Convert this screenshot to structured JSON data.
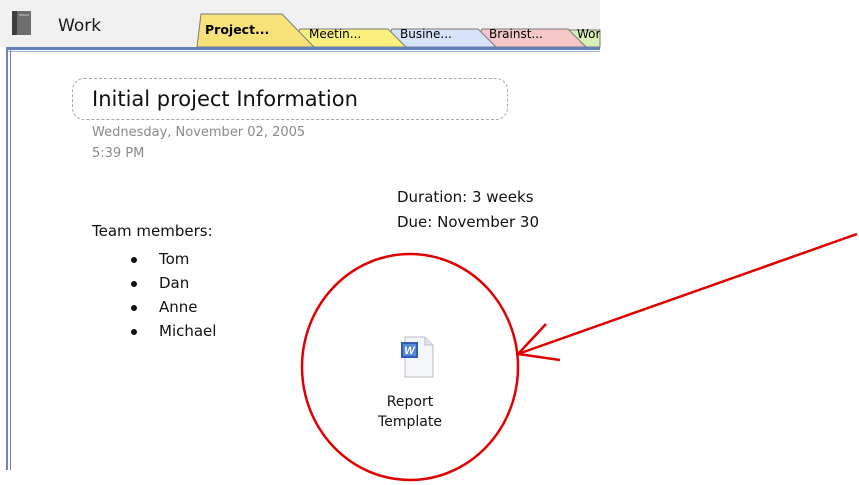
{
  "notebook": {
    "title": "Work",
    "icon": "notebook-icon"
  },
  "tabs": [
    {
      "label": "Project...",
      "active": true,
      "color": "#f7e27a"
    },
    {
      "label": "Meetin...",
      "active": false,
      "color": "#fbf07e"
    },
    {
      "label": "Busine...",
      "active": false,
      "color": "#d6e2f7"
    },
    {
      "label": "Brainst...",
      "active": false,
      "color": "#f5c7c7"
    },
    {
      "label": "Wor",
      "active": false,
      "color": "#d8efb8"
    }
  ],
  "page": {
    "title": "Initial project Information",
    "date": "Wednesday, November 02, 2005",
    "time": "5:39 PM",
    "duration": "Duration: 3 weeks",
    "due": "Due: November 30",
    "team_label": "Team members:",
    "team_members": [
      "Tom",
      "Dan",
      "Anne",
      "Michael"
    ],
    "attachment": {
      "icon": "word-document-icon",
      "line1": "Report",
      "line2": "Template"
    }
  },
  "annotation": {
    "color": "#e00000",
    "shapes": [
      "circle",
      "arrow"
    ]
  }
}
